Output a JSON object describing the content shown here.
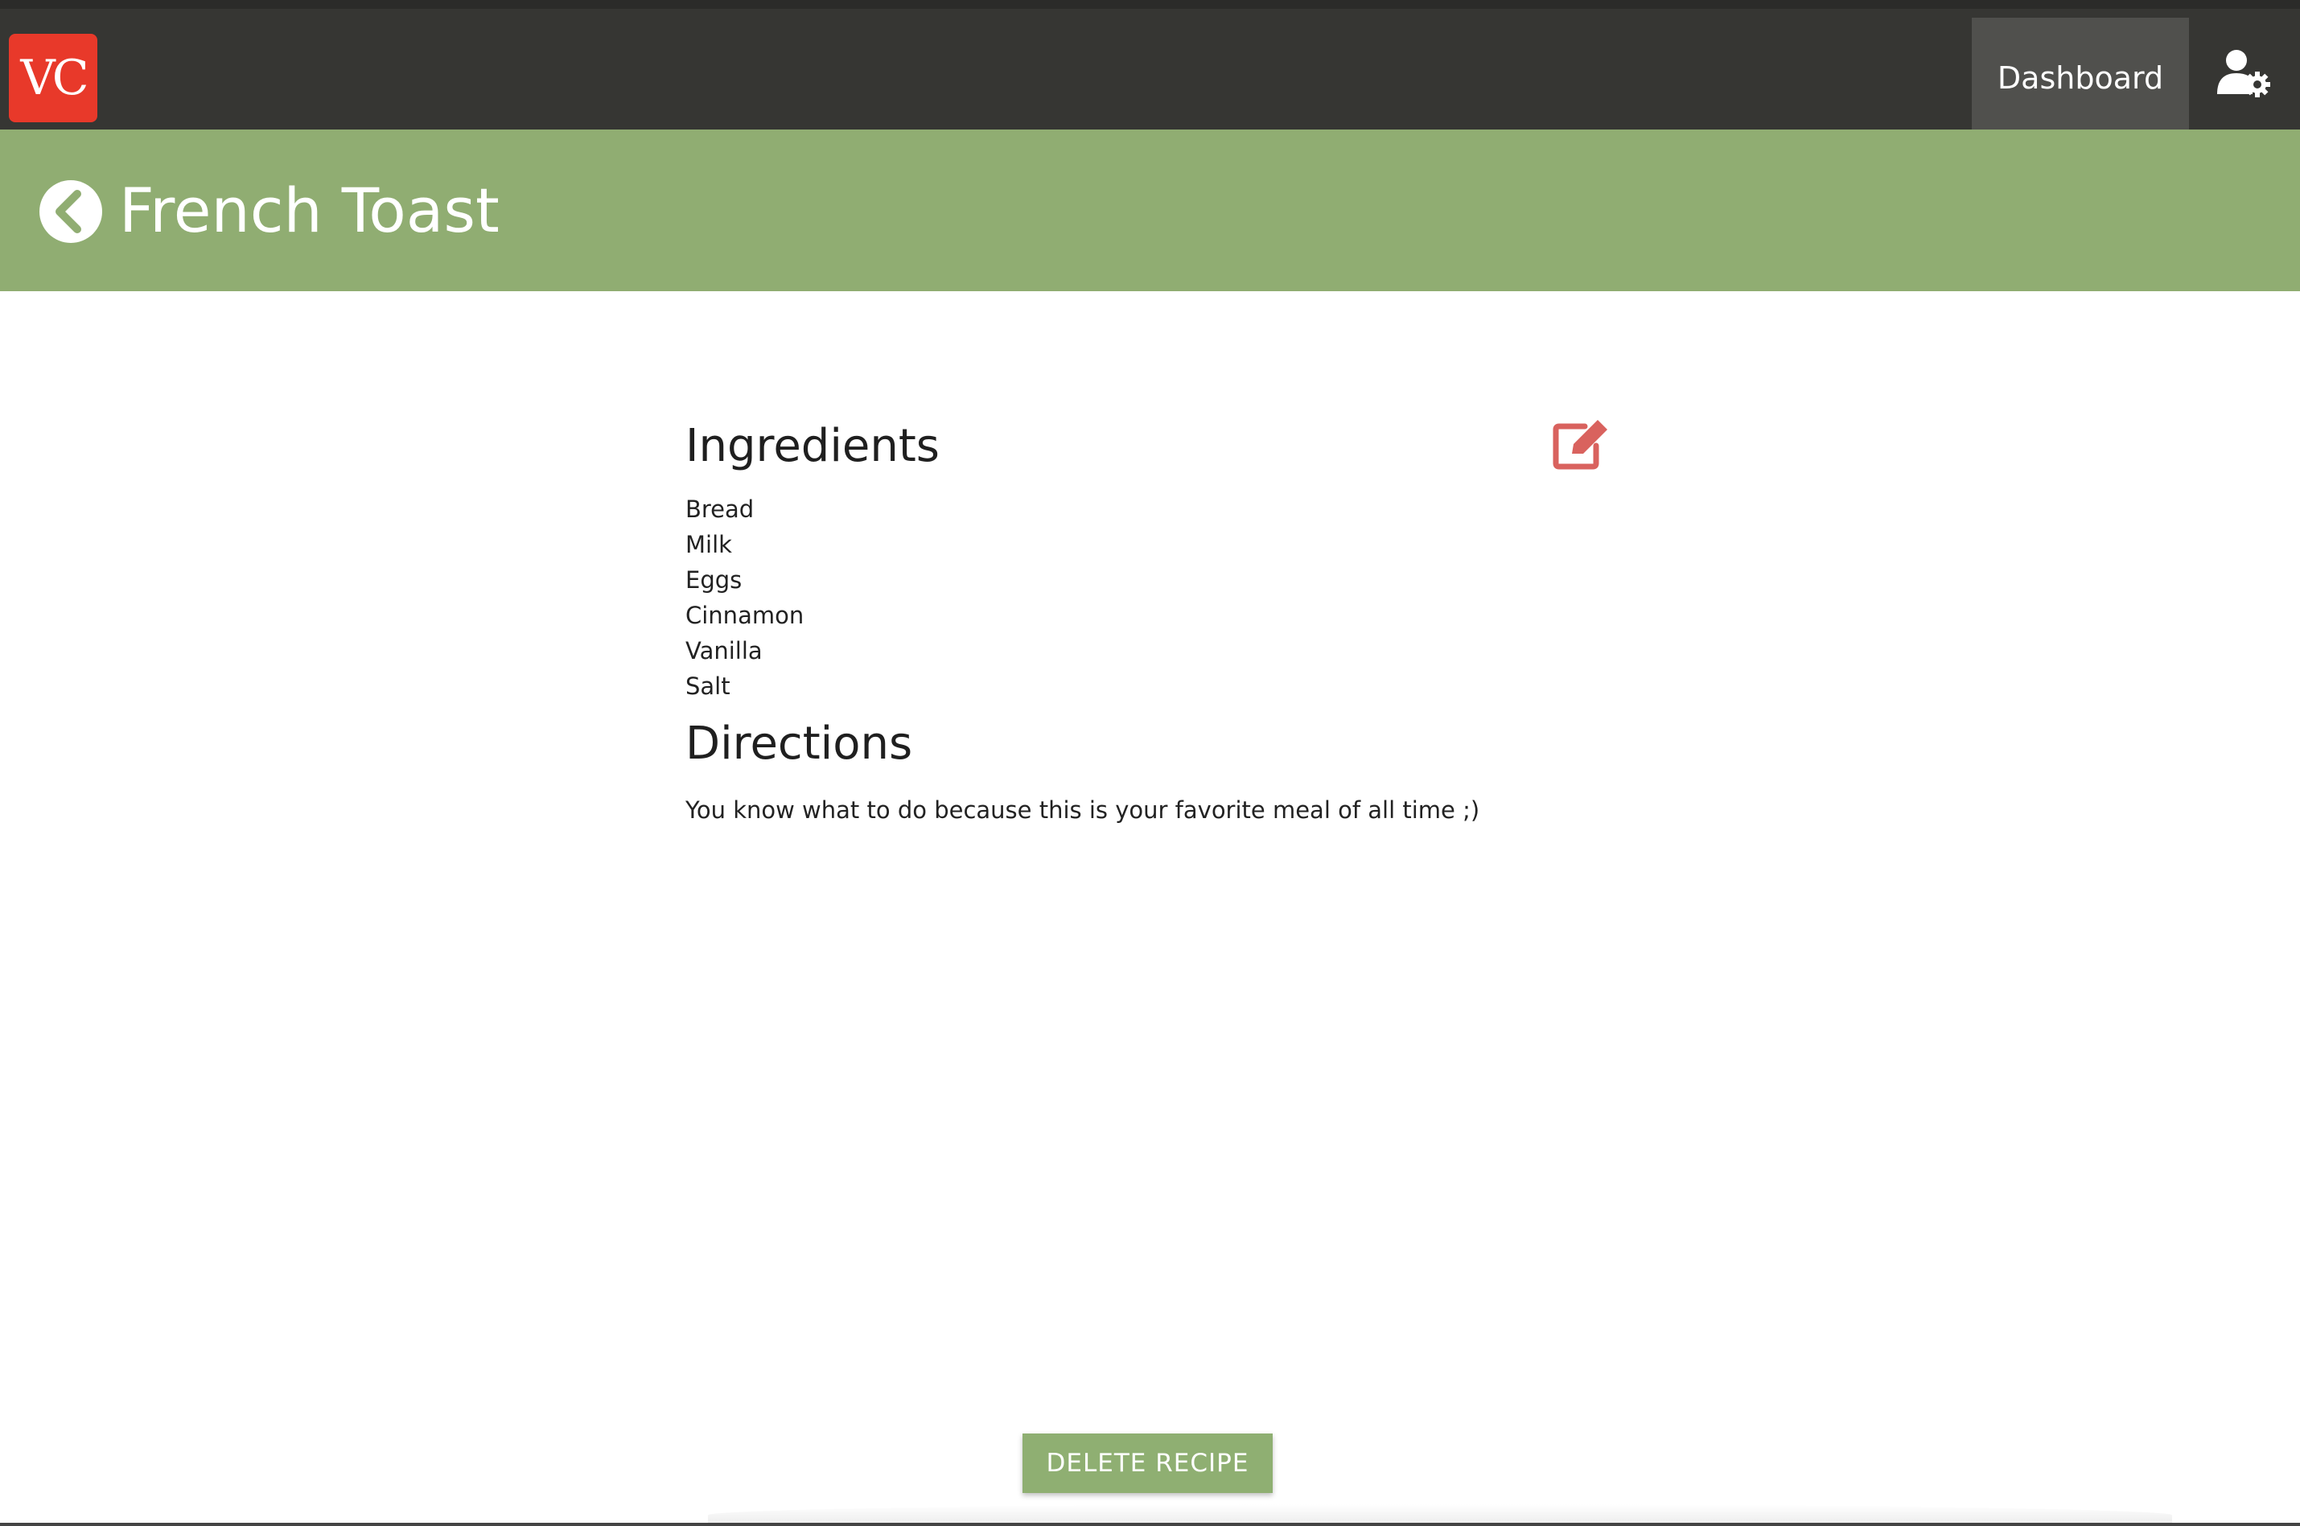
{
  "nav": {
    "logo_text": "VC",
    "dashboard_label": "Dashboard",
    "user_settings_icon": "user-cog-icon"
  },
  "header": {
    "back_icon": "chevron-left-circle-icon",
    "title": "French Toast"
  },
  "recipe": {
    "ingredients_heading": "Ingredients",
    "ingredients": [
      "Bread",
      "Milk",
      "Eggs",
      "Cinnamon",
      "Vanilla",
      "Salt"
    ],
    "directions_heading": "Directions",
    "directions": "You know what to do because this is your favorite meal of all time ;)",
    "edit_icon": "edit-icon"
  },
  "actions": {
    "delete_label": "DELETE RECIPE"
  },
  "colors": {
    "topbar": "#363633",
    "logo": "#e8392a",
    "header": "#90ad72",
    "edit_icon": "#d9625e",
    "delete_button": "#8faf72"
  }
}
